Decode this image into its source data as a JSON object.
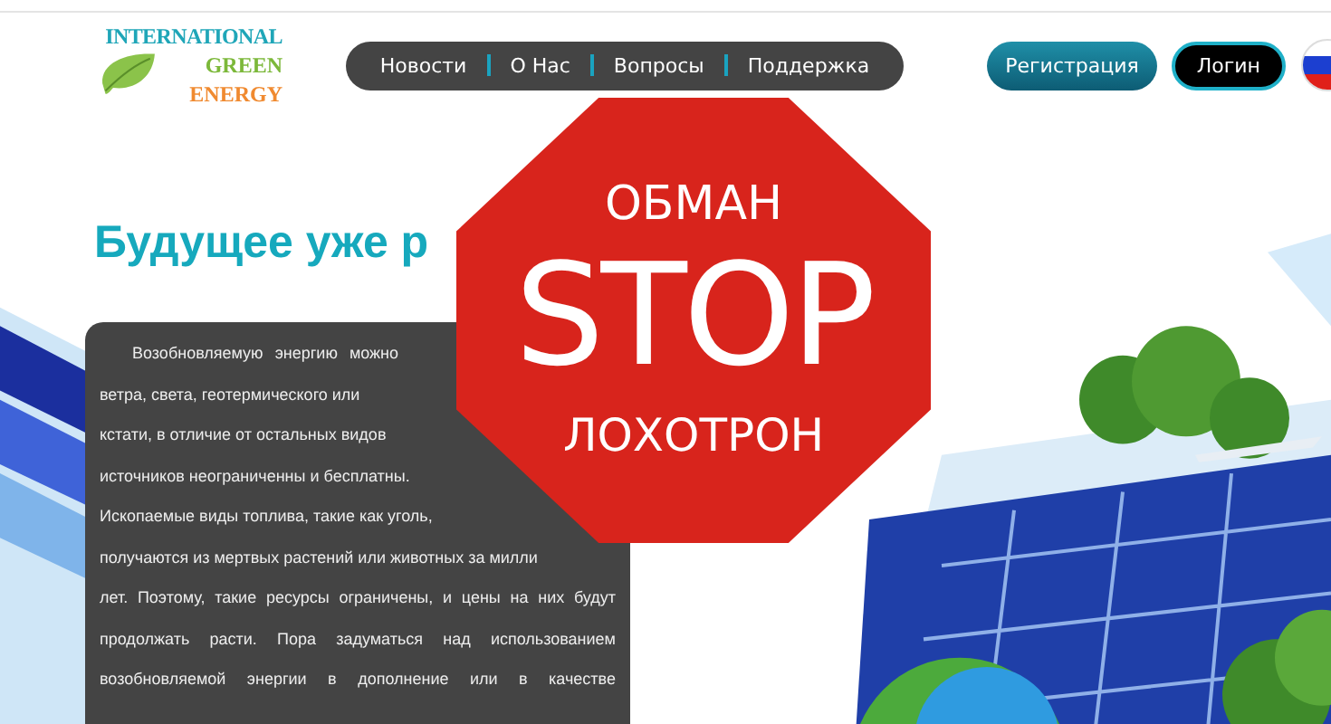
{
  "logo": {
    "line_1": "INTERNATIONAL",
    "line_2": "GREEN",
    "line_3": "ENERGY"
  },
  "nav": [
    "Новости",
    "О Нас",
    "Вопросы",
    "Поддержка"
  ],
  "buttons": [
    {
      "label": "Регистрация",
      "kind": "primary"
    },
    {
      "label": "Логин",
      "kind": "dark"
    }
  ],
  "hero": {
    "heading": "Будущее уже р",
    "lines": [
      {
        "text": "Возобновляемую энергию можно",
        "kind": "first"
      },
      {
        "text": "ветра, света, геотермического или",
        "kind": "plain"
      },
      {
        "text": "кстати, в отличие от остальных видов",
        "kind": "plain"
      },
      {
        "text": "источников неограниченны и бесплатны.",
        "kind": "plain"
      },
      {
        "text": "Ископаемые виды топлива, такие как уголь,",
        "kind": "plain"
      },
      {
        "text": "получаются из мертвых растений или животных за милли",
        "kind": "plain"
      },
      {
        "text": "лет. Поэтому, такие ресурсы ограничены, и цены на них будут",
        "kind": "justified"
      },
      {
        "text": "продолжать расти. Пора задуматься над использованием",
        "kind": "justified"
      },
      {
        "text": "возобновляемой энергии в дополнение или в качестве",
        "kind": "justified"
      }
    ]
  },
  "stop_sign": {
    "top": "ОБМАН",
    "middle": "STOP",
    "bottom": "ЛОХОТРОН"
  }
}
